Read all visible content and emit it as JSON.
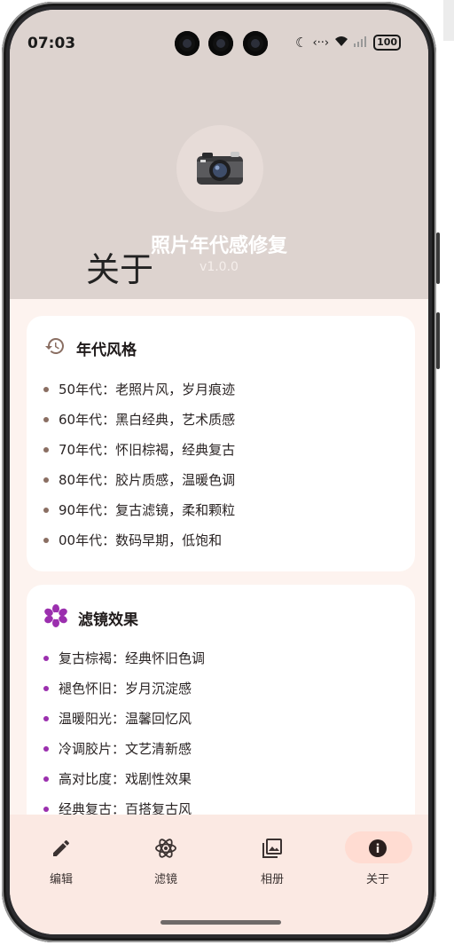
{
  "status_bar": {
    "time": "07:03",
    "battery": "100",
    "icons": [
      "moon-icon",
      "data-transfer-icon",
      "wifi-icon",
      "signal-icon",
      "battery-icon"
    ]
  },
  "header": {
    "app_name": "照片年代感修复",
    "version": "v1.0.0",
    "page_title": "关于",
    "logo_icon": "camera-icon"
  },
  "era_card": {
    "title": "年代风格",
    "icon": "history-icon",
    "bullet_color": "#8a6e62",
    "items": [
      "50年代：老照片风，岁月痕迹",
      "60年代：黑白经典，艺术质感",
      "70年代：怀旧棕褐，经典复古",
      "80年代：胶片质感，温暖色调",
      "90年代：复古滤镜，柔和颗粒",
      "00年代：数码早期，低饱和"
    ]
  },
  "filter_card": {
    "title": "滤镜效果",
    "icon": "flower-icon",
    "accent_color": "#9b2fae",
    "items": [
      "复古棕褐：经典怀旧色调",
      "褪色怀旧：岁月沉淀感",
      "温暖阳光：温馨回忆风",
      "冷调胶片：文艺清新感",
      "高对比度：戏剧性效果",
      "经典复古：百搭复古风"
    ]
  },
  "nav": {
    "items": [
      {
        "label": "编辑",
        "icon": "pencil-icon"
      },
      {
        "label": "滤镜",
        "icon": "atom-icon"
      },
      {
        "label": "相册",
        "icon": "photo-library-icon"
      },
      {
        "label": "关于",
        "icon": "info-icon"
      }
    ],
    "active": "关于"
  }
}
